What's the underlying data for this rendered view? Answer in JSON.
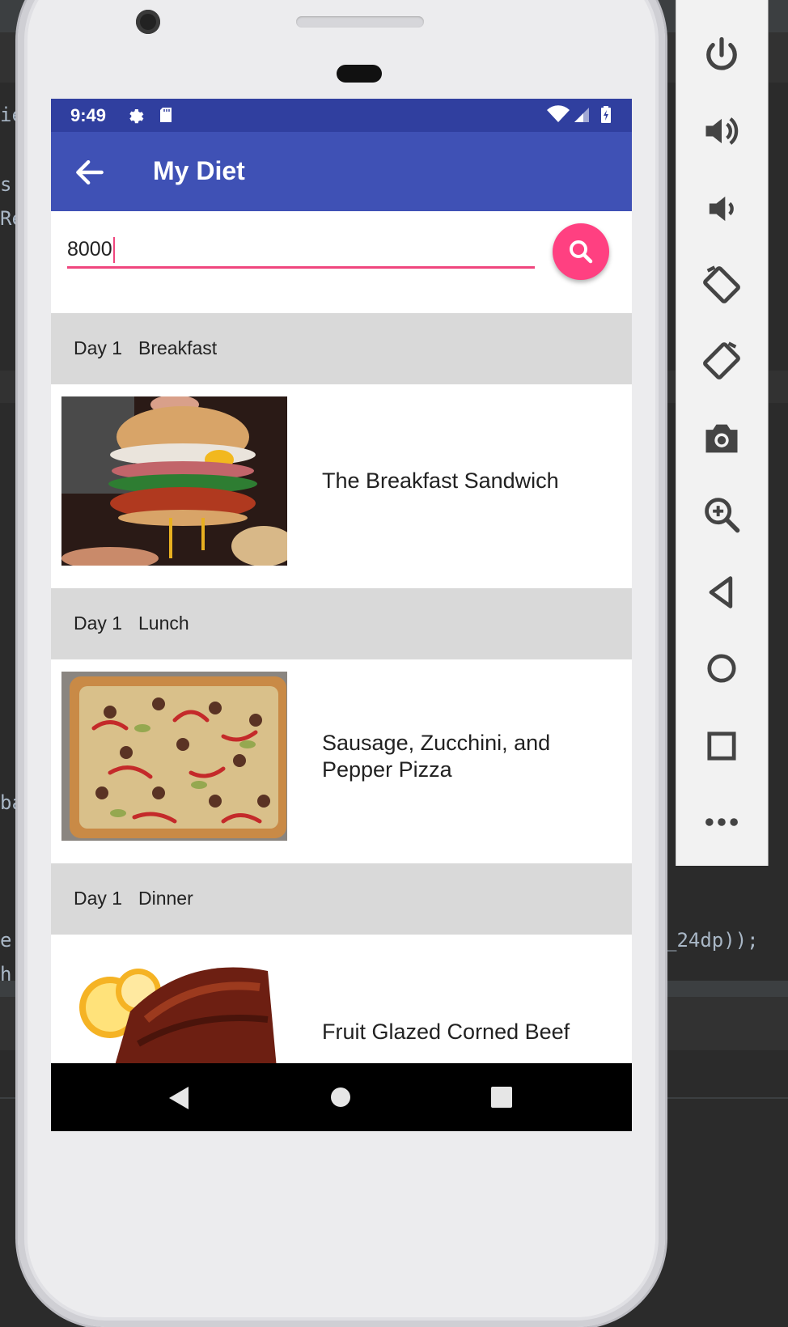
{
  "status_bar": {
    "time": "9:49"
  },
  "app_bar": {
    "title": "My Diet"
  },
  "search": {
    "value": "8000"
  },
  "sections": [
    {
      "day": "Day 1",
      "meal": "Breakfast",
      "recipe": "The Breakfast Sandwich"
    },
    {
      "day": "Day 1",
      "meal": "Lunch",
      "recipe": "Sausage, Zucchini, and Pepper Pizza"
    },
    {
      "day": "Day 1",
      "meal": "Dinner",
      "recipe": "Fruit Glazed Corned Beef"
    }
  ],
  "ide_code": {
    "line1": "ie",
    "line2": "s;",
    "line3": "Re",
    "line4": "ba",
    "line5_left": "e(",
    "line5_right": "_24dp));",
    "line6": "h"
  },
  "colors": {
    "status_bar": "#303f9f",
    "app_bar": "#3f51b5",
    "accent": "#ff4081",
    "section_header": "#d9d9d9"
  },
  "emulator_controls": [
    "power-icon",
    "volume-up-icon",
    "volume-down-icon",
    "rotate-left-icon",
    "rotate-right-icon",
    "camera-icon",
    "zoom-icon",
    "back-icon",
    "home-icon",
    "overview-icon",
    "more-icon"
  ]
}
